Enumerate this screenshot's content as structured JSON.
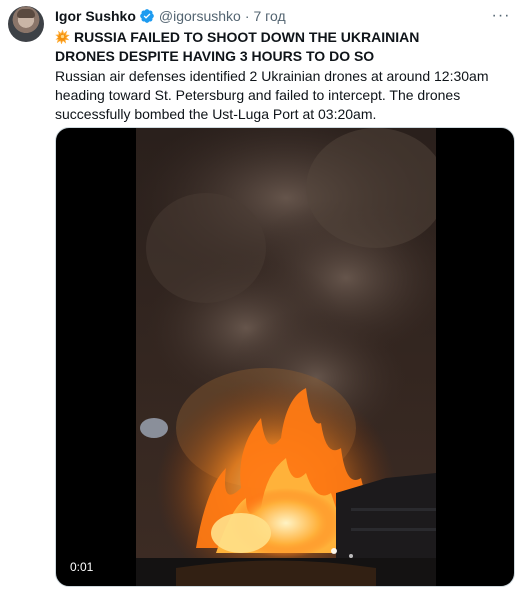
{
  "author": {
    "name": "Igor Sushko",
    "handle": "@igorsushko",
    "separator": "·",
    "time": "7 год"
  },
  "tweet": {
    "emoji_icon": "collision-icon",
    "headline": "RUSSIA FAILED TO SHOOT DOWN THE UKRAINIAN DRONES DESPITE HAVING 3 HOURS TO DO SO",
    "body": "Russian air defenses identified 2 Ukrainian drones at around 12:30am heading toward St. Petersburg and failed to intercept. The drones successfully bombed the Ust-Luga Port at 03:20am."
  },
  "media": {
    "timestamp": "0:01"
  },
  "menu": {
    "more_icon": "more-horizontal-icon",
    "label": "···"
  },
  "colors": {
    "text": "#0f1419",
    "secondary": "#536471",
    "verified": "#1d9bf0"
  }
}
